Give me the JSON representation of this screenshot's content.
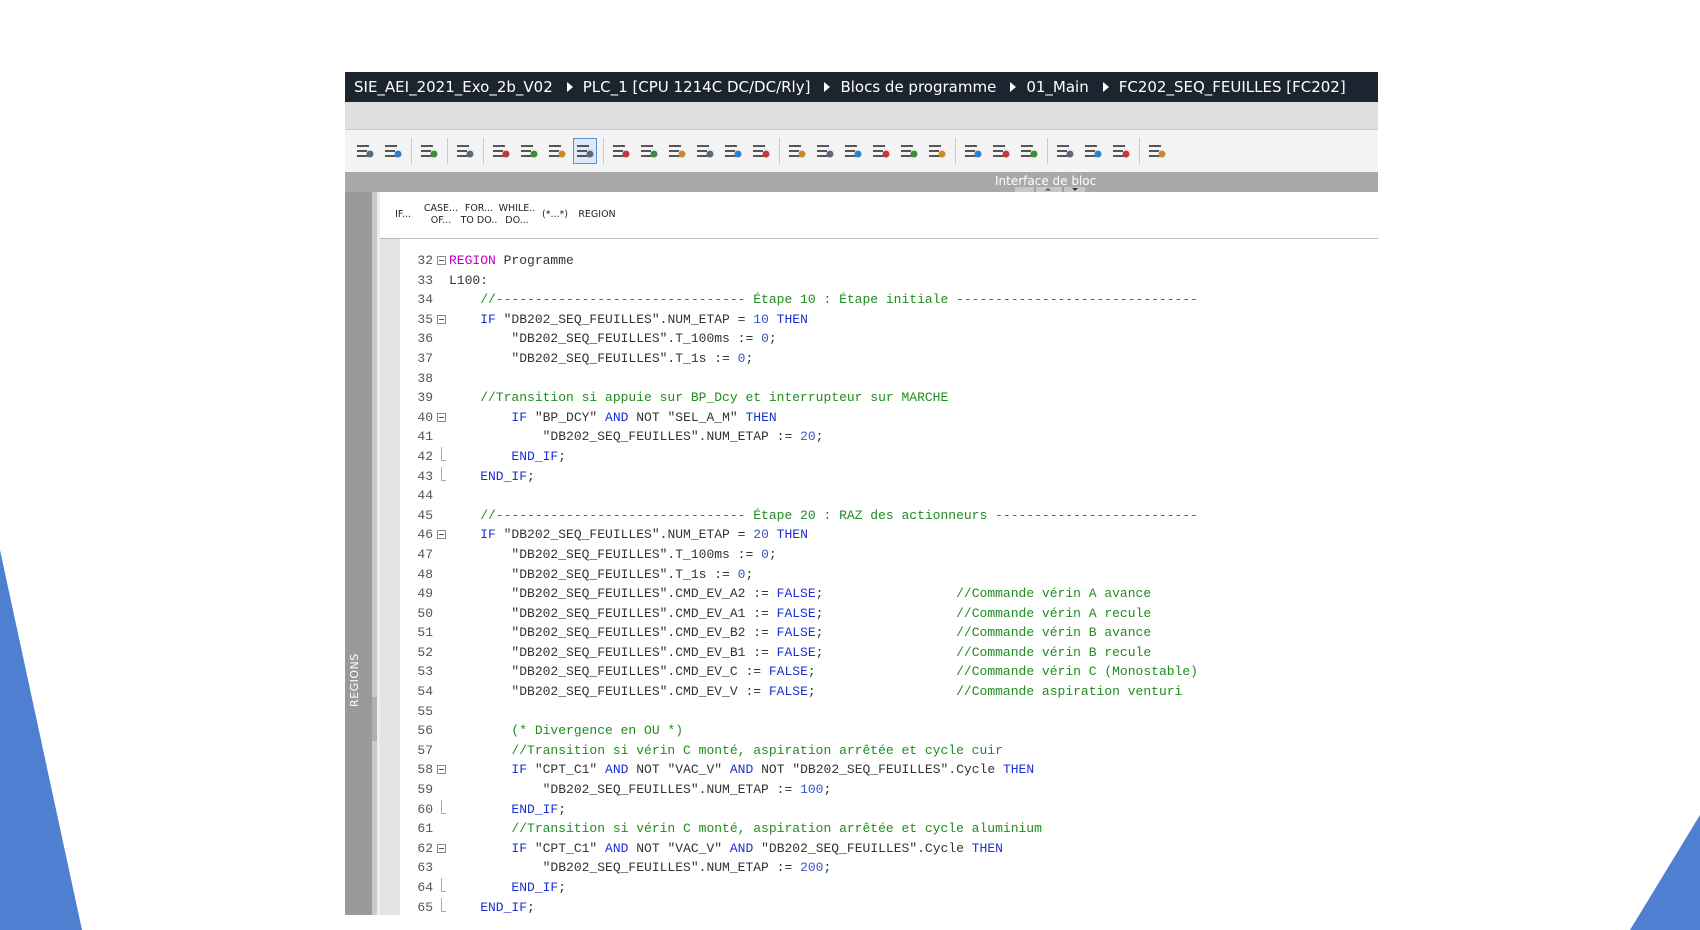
{
  "app": {
    "breadcrumb": [
      "SIE_AEI_2021_Exo_2b_V02",
      "PLC_1 [CPU 1214C DC/DC/Rly]",
      "Blocs de programme",
      "01_Main",
      "FC202_SEQ_FEUILLES [FC202]"
    ]
  },
  "panel": {
    "title": "Interface de bloc"
  },
  "left_strip": {
    "label": "REGIONS"
  },
  "scl_toolbar": [
    {
      "name": "if",
      "line1": "IF...",
      "line2": ""
    },
    {
      "name": "case-of",
      "line1": "CASE...",
      "line2": "OF..."
    },
    {
      "name": "for-to-do",
      "line1": "FOR...",
      "line2": "TO DO.."
    },
    {
      "name": "while-do",
      "line1": "WHILE..",
      "line2": "DO..."
    },
    {
      "name": "comment",
      "line1": "(*...*)",
      "line2": ""
    },
    {
      "name": "region",
      "line1": "REGION",
      "line2": ""
    }
  ],
  "toolbar_icons": [
    "indent-icon",
    "outdent-icon",
    "sep",
    "go-to-icon",
    "sep",
    "clear-icon",
    "sep",
    "list-icon",
    "compile-icon",
    "download-icon",
    "highlight-icon",
    "sep",
    "remove-breakpoint-icon",
    "delete-breakpoint-icon",
    "insert-icon",
    "watch-icon",
    "comment-icon",
    "check-icon",
    "sep",
    "indent-left-icon",
    "indent-right-icon",
    "indent-block-icon",
    "network-icon",
    "bookmark-icon",
    "bookmark-remove-icon",
    "sep",
    "monitor-icon",
    "refresh-icon",
    "reload-icon",
    "sep",
    "connection-icon",
    "compare-icon",
    "compare-offline-icon",
    "sep",
    "database-icon"
  ],
  "code_lines": [
    {
      "n": "32",
      "fold": "open",
      "tokens": [
        [
          "region-kw",
          "REGION"
        ],
        [
          "id",
          " Programme"
        ]
      ]
    },
    {
      "n": "33",
      "fold": "",
      "tokens": [
        [
          "id",
          "L100:"
        ]
      ]
    },
    {
      "n": "34",
      "fold": "",
      "tokens": [
        [
          "cm",
          "    //-------------------------------- Étape 10 : Étape initiale -------------------------------"
        ]
      ]
    },
    {
      "n": "35",
      "fold": "open",
      "tokens": [
        [
          "kw",
          "    IF"
        ],
        [
          "str",
          " \"DB202_SEQ_FEUILLES\".NUM_ETAP = "
        ],
        [
          "num",
          "10"
        ],
        [
          "kw",
          " THEN"
        ]
      ]
    },
    {
      "n": "36",
      "fold": "",
      "tokens": [
        [
          "str",
          "        \"DB202_SEQ_FEUILLES\".T_100ms := "
        ],
        [
          "num",
          "0"
        ],
        [
          "id",
          ";"
        ]
      ]
    },
    {
      "n": "37",
      "fold": "",
      "tokens": [
        [
          "str",
          "        \"DB202_SEQ_FEUILLES\".T_1s := "
        ],
        [
          "num",
          "0"
        ],
        [
          "id",
          ";"
        ]
      ]
    },
    {
      "n": "38",
      "fold": "",
      "tokens": [
        [
          "id",
          ""
        ]
      ]
    },
    {
      "n": "39",
      "fold": "",
      "tokens": [
        [
          "cm",
          "    //Transition si appuie sur BP_Dcy et interrupteur sur MARCHE"
        ]
      ]
    },
    {
      "n": "40",
      "fold": "open",
      "tokens": [
        [
          "kw",
          "        IF"
        ],
        [
          "str",
          " \"BP_DCY\""
        ],
        [
          "kw",
          " AND"
        ],
        [
          "id",
          " NOT "
        ],
        [
          "str",
          "\"SEL_A_M\""
        ],
        [
          "kw",
          " THEN"
        ]
      ]
    },
    {
      "n": "41",
      "fold": "",
      "tokens": [
        [
          "str",
          "            \"DB202_SEQ_FEUILLES\".NUM_ETAP := "
        ],
        [
          "num",
          "20"
        ],
        [
          "id",
          ";"
        ]
      ]
    },
    {
      "n": "42",
      "fold": "end",
      "tokens": [
        [
          "kw",
          "        END_IF"
        ],
        [
          "id",
          ";"
        ]
      ]
    },
    {
      "n": "43",
      "fold": "end",
      "tokens": [
        [
          "kw",
          "    END_IF"
        ],
        [
          "id",
          ";"
        ]
      ]
    },
    {
      "n": "44",
      "fold": "",
      "tokens": [
        [
          "id",
          ""
        ]
      ]
    },
    {
      "n": "45",
      "fold": "",
      "tokens": [
        [
          "cm",
          "    //-------------------------------- Étape 20 : RAZ des actionneurs --------------------------"
        ]
      ]
    },
    {
      "n": "46",
      "fold": "open",
      "tokens": [
        [
          "kw",
          "    IF"
        ],
        [
          "str",
          " \"DB202_SEQ_FEUILLES\".NUM_ETAP = "
        ],
        [
          "num",
          "20"
        ],
        [
          "kw",
          " THEN"
        ]
      ]
    },
    {
      "n": "47",
      "fold": "",
      "tokens": [
        [
          "str",
          "        \"DB202_SEQ_FEUILLES\".T_100ms := "
        ],
        [
          "num",
          "0"
        ],
        [
          "id",
          ";"
        ]
      ]
    },
    {
      "n": "48",
      "fold": "",
      "tokens": [
        [
          "str",
          "        \"DB202_SEQ_FEUILLES\".T_1s := "
        ],
        [
          "num",
          "0"
        ],
        [
          "id",
          ";"
        ]
      ]
    },
    {
      "n": "49",
      "fold": "",
      "tokens": [
        [
          "str",
          "        \"DB202_SEQ_FEUILLES\".CMD_EV_A2 := "
        ],
        [
          "kw",
          "FALSE"
        ],
        [
          "id",
          ";                 "
        ],
        [
          "cm",
          "//Commande vérin A avance"
        ]
      ]
    },
    {
      "n": "50",
      "fold": "",
      "tokens": [
        [
          "str",
          "        \"DB202_SEQ_FEUILLES\".CMD_EV_A1 := "
        ],
        [
          "kw",
          "FALSE"
        ],
        [
          "id",
          ";                 "
        ],
        [
          "cm",
          "//Commande vérin A recule"
        ]
      ]
    },
    {
      "n": "51",
      "fold": "",
      "tokens": [
        [
          "str",
          "        \"DB202_SEQ_FEUILLES\".CMD_EV_B2 := "
        ],
        [
          "kw",
          "FALSE"
        ],
        [
          "id",
          ";                 "
        ],
        [
          "cm",
          "//Commande vérin B avance"
        ]
      ]
    },
    {
      "n": "52",
      "fold": "",
      "tokens": [
        [
          "str",
          "        \"DB202_SEQ_FEUILLES\".CMD_EV_B1 := "
        ],
        [
          "kw",
          "FALSE"
        ],
        [
          "id",
          ";                 "
        ],
        [
          "cm",
          "//Commande vérin B recule"
        ]
      ]
    },
    {
      "n": "53",
      "fold": "",
      "tokens": [
        [
          "str",
          "        \"DB202_SEQ_FEUILLES\".CMD_EV_C := "
        ],
        [
          "kw",
          "FALSE"
        ],
        [
          "id",
          ";                  "
        ],
        [
          "cm",
          "//Commande vérin C (Monostable)"
        ]
      ]
    },
    {
      "n": "54",
      "fold": "",
      "tokens": [
        [
          "str",
          "        \"DB202_SEQ_FEUILLES\".CMD_EV_V := "
        ],
        [
          "kw",
          "FALSE"
        ],
        [
          "id",
          ";                  "
        ],
        [
          "cm",
          "//Commande aspiration venturi"
        ]
      ]
    },
    {
      "n": "55",
      "fold": "",
      "tokens": [
        [
          "id",
          ""
        ]
      ]
    },
    {
      "n": "56",
      "fold": "",
      "tokens": [
        [
          "cm",
          "        (* Divergence en OU *)"
        ]
      ]
    },
    {
      "n": "57",
      "fold": "",
      "tokens": [
        [
          "cm",
          "        //Transition si vérin C monté, aspiration arrêtée et cycle cuir"
        ]
      ]
    },
    {
      "n": "58",
      "fold": "open",
      "tokens": [
        [
          "kw",
          "        IF"
        ],
        [
          "str",
          " \"CPT_C1\""
        ],
        [
          "kw",
          " AND"
        ],
        [
          "id",
          " NOT "
        ],
        [
          "str",
          "\"VAC_V\""
        ],
        [
          "kw",
          " AND"
        ],
        [
          "id",
          " NOT "
        ],
        [
          "str",
          "\"DB202_SEQ_FEUILLES\".Cycle"
        ],
        [
          "kw",
          " THEN"
        ]
      ]
    },
    {
      "n": "59",
      "fold": "",
      "tokens": [
        [
          "str",
          "            \"DB202_SEQ_FEUILLES\".NUM_ETAP := "
        ],
        [
          "num",
          "100"
        ],
        [
          "id",
          ";"
        ]
      ]
    },
    {
      "n": "60",
      "fold": "end",
      "tokens": [
        [
          "kw",
          "        END_IF"
        ],
        [
          "id",
          ";"
        ]
      ]
    },
    {
      "n": "61",
      "fold": "",
      "tokens": [
        [
          "cm",
          "        //Transition si vérin C monté, aspiration arrêtée et cycle aluminium"
        ]
      ]
    },
    {
      "n": "62",
      "fold": "open",
      "tokens": [
        [
          "kw",
          "        IF"
        ],
        [
          "str",
          " \"CPT_C1\""
        ],
        [
          "kw",
          " AND"
        ],
        [
          "id",
          " NOT "
        ],
        [
          "str",
          "\"VAC_V\""
        ],
        [
          "kw",
          " AND"
        ],
        [
          "str",
          " \"DB202_SEQ_FEUILLES\".Cycle"
        ],
        [
          "kw",
          " THEN"
        ]
      ]
    },
    {
      "n": "63",
      "fold": "",
      "tokens": [
        [
          "str",
          "            \"DB202_SEQ_FEUILLES\".NUM_ETAP := "
        ],
        [
          "num",
          "200"
        ],
        [
          "id",
          ";"
        ]
      ]
    },
    {
      "n": "64",
      "fold": "end",
      "tokens": [
        [
          "kw",
          "        END_IF"
        ],
        [
          "id",
          ";"
        ]
      ]
    },
    {
      "n": "65",
      "fold": "end",
      "tokens": [
        [
          "kw",
          "    END_IF"
        ],
        [
          "id",
          ";"
        ]
      ]
    }
  ],
  "colors": {
    "keyword": "#1c2fd6",
    "region_keyword": "#c200c2",
    "comment": "#1f8c1f",
    "number": "#3a54c8",
    "titlebar": "#1c2430",
    "accent": "#4f7fd0"
  }
}
